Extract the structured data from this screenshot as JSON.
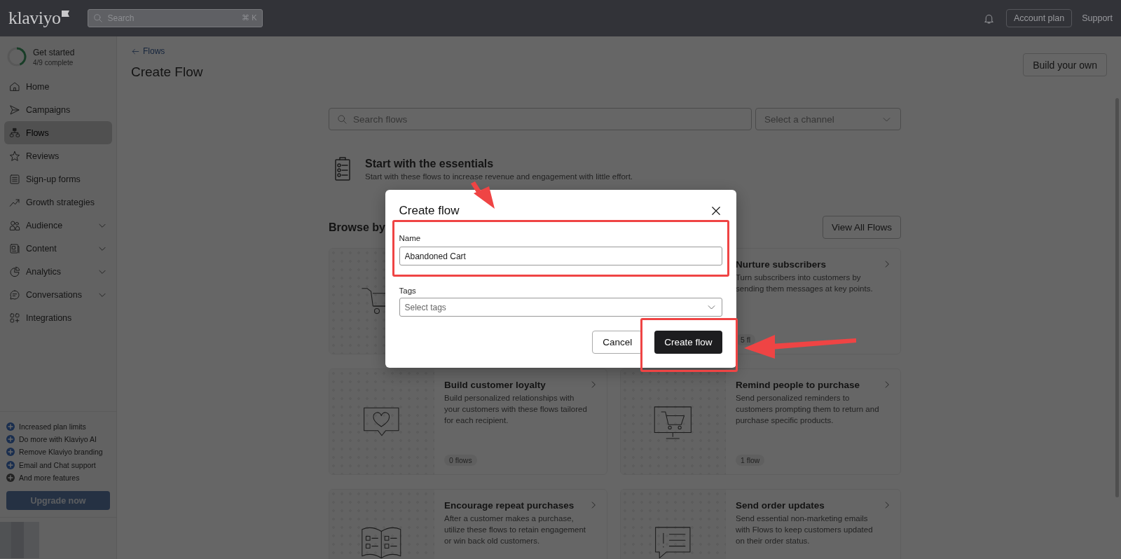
{
  "topbar": {
    "logo": "klaviyo",
    "search_placeholder": "Search",
    "shortcut": "⌘ K",
    "account_button": "Account plan",
    "support_link": "Support"
  },
  "sidebar": {
    "progress": {
      "title": "Get started",
      "subtitle": "4/9 complete",
      "level": 0.44
    },
    "items": [
      {
        "label": "Home",
        "selected": false,
        "expandable": false
      },
      {
        "label": "Campaigns",
        "selected": false,
        "expandable": false
      },
      {
        "label": "Flows",
        "selected": true,
        "expandable": false
      },
      {
        "label": "Reviews",
        "selected": false,
        "expandable": false
      },
      {
        "label": "Sign-up forms",
        "selected": false,
        "expandable": false
      },
      {
        "label": "Growth strategies",
        "selected": false,
        "expandable": false
      },
      {
        "label": "Audience",
        "selected": false,
        "expandable": true
      },
      {
        "label": "Content",
        "selected": false,
        "expandable": true
      },
      {
        "label": "Analytics",
        "selected": false,
        "expandable": true
      },
      {
        "label": "Conversations",
        "selected": false,
        "expandable": true
      },
      {
        "label": "Integrations",
        "selected": false,
        "expandable": false
      }
    ],
    "features": [
      {
        "label": "Increased plan limits",
        "kind": "plan"
      },
      {
        "label": "Do more with Klaviyo AI",
        "kind": "plan"
      },
      {
        "label": "Remove Klaviyo branding",
        "kind": "plan"
      },
      {
        "label": "Email and Chat support",
        "kind": "plan"
      },
      {
        "label": "And more features",
        "kind": "more"
      }
    ],
    "upgrade_button": "Upgrade now"
  },
  "page": {
    "back_link": "Flows",
    "title": "Create Flow",
    "build_button": "Build your own",
    "search_placeholder": "Search flows",
    "channel_placeholder": "Select a channel",
    "essentials": {
      "title": "Start with the essentials",
      "description": "Start with these flows to increase revenue and engagement with little effort."
    },
    "browse_title": "Browse by",
    "view_all_button": "View All Flows",
    "cards": [
      {
        "kind": "covered"
      },
      {
        "kind": "full",
        "title": "Nurture subscribers",
        "description": "Turn subscribers into customers by sending them messages at key points.",
        "count": "5 fl"
      },
      {
        "kind": "full",
        "title": "Build customer loyalty",
        "description": "Build personalized relationships with your customers with these flows tailored for each recipient.",
        "count": "0 flows"
      },
      {
        "kind": "full",
        "title": "Remind people to purchase",
        "description": "Send personalized reminders to customers prompting them to return and purchase specific products.",
        "count": "1 flow"
      },
      {
        "kind": "full",
        "title": "Encourage repeat purchases",
        "description": "After a customer makes a purchase, utilize these flows to retain engagement or win back old customers."
      },
      {
        "kind": "full",
        "title": "Send order updates",
        "description": "Send essential non-marketing emails with Flows to keep customers updated on their order status."
      }
    ]
  },
  "modal": {
    "title": "Create flow",
    "name_label": "Name",
    "name_value": "Abandoned Cart",
    "tags_label": "Tags",
    "tags_placeholder": "Select tags",
    "cancel_button": "Cancel",
    "submit_button": "Create flow"
  }
}
